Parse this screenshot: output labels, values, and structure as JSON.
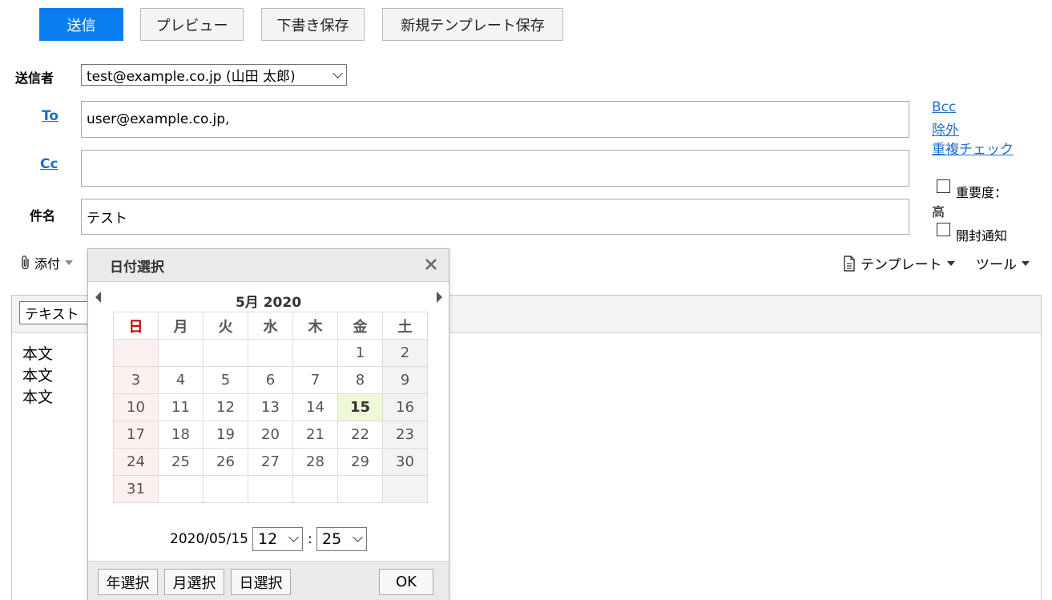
{
  "toolbar": {
    "send": "送信",
    "preview": "プレビュー",
    "save_draft": "下書き保存",
    "save_template": "新規テンプレート保存"
  },
  "sender": {
    "label": "送信者",
    "value": "test@example.co.jp (山田 太郎)"
  },
  "to": {
    "label": "To",
    "value": "user@example.co.jp,"
  },
  "cc": {
    "label": "Cc",
    "value": ""
  },
  "subject": {
    "label": "件名",
    "value": "テスト"
  },
  "side_links": {
    "bcc": "Bcc",
    "exclude": "除外",
    "duplicate_check": "重複チェック"
  },
  "options": {
    "priority": "重要度：",
    "priority_value": "高",
    "read_receipt": "開封通知"
  },
  "attach": {
    "label": "添付"
  },
  "menus": {
    "template": "テンプレート",
    "tools": "ツール"
  },
  "editor": {
    "format_select": "テキスト",
    "body_lines": [
      "本文",
      "本文",
      "本文"
    ]
  },
  "date_picker": {
    "title": "日付選択",
    "month_label": "5月 2020",
    "weekdays": [
      "日",
      "月",
      "火",
      "水",
      "木",
      "金",
      "土"
    ],
    "weeks": [
      [
        "",
        "",
        "",
        "",
        "",
        "1",
        "2"
      ],
      [
        "3",
        "4",
        "5",
        "6",
        "7",
        "8",
        "9"
      ],
      [
        "10",
        "11",
        "12",
        "13",
        "14",
        "15",
        "16"
      ],
      [
        "17",
        "18",
        "19",
        "20",
        "21",
        "22",
        "23"
      ],
      [
        "24",
        "25",
        "26",
        "27",
        "28",
        "29",
        "30"
      ],
      [
        "31",
        "",
        "",
        "",
        "",
        "",
        ""
      ]
    ],
    "selected_day": "15",
    "selected_date": "2020/05/15",
    "hour": "12",
    "minute": "25",
    "time_sep": ":",
    "buttons": {
      "year": "年選択",
      "month": "月選択",
      "day": "日選択",
      "ok": "OK"
    }
  },
  "colors": {
    "primary": "#0a7ef0",
    "link": "#1a6fcf",
    "sunday": "#c00000",
    "today_bg": "#eef8d8"
  }
}
